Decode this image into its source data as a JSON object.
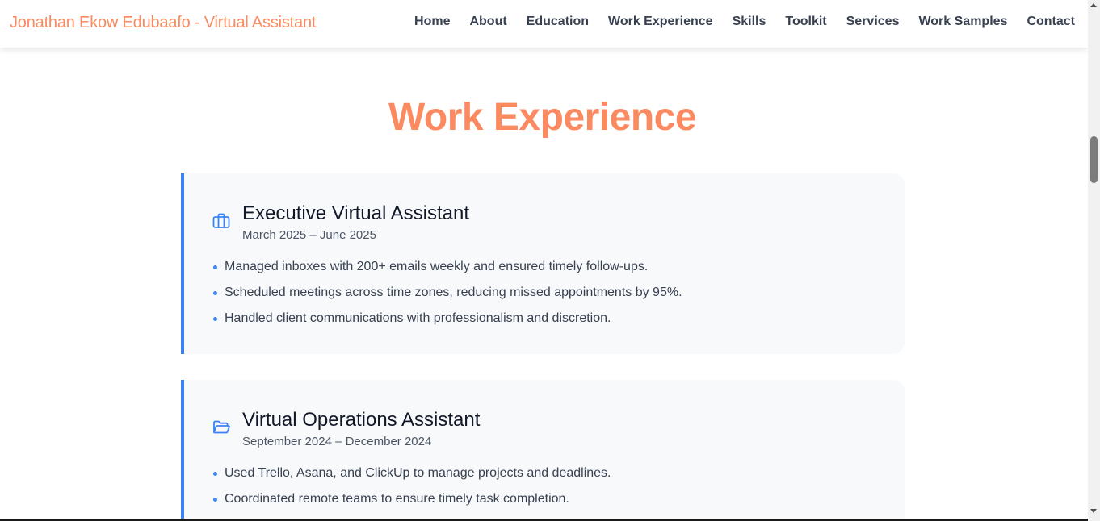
{
  "header": {
    "brand": "Jonathan Ekow Edubaafo - Virtual Assistant",
    "nav": [
      "Home",
      "About",
      "Education",
      "Work Experience",
      "Skills",
      "Toolkit",
      "Services",
      "Work Samples",
      "Contact"
    ]
  },
  "section": {
    "title": "Work Experience"
  },
  "jobs": [
    {
      "icon": "briefcase-icon",
      "title": "Executive Virtual Assistant",
      "dates": "March 2025 – June 2025",
      "bullets": [
        "Managed inboxes with 200+ emails weekly and ensured timely follow-ups.",
        "Scheduled meetings across time zones, reducing missed appointments by 95%.",
        "Handled client communications with professionalism and discretion."
      ]
    },
    {
      "icon": "folder-open-icon",
      "title": "Virtual Operations Assistant",
      "dates": "September 2024 – December 2024",
      "bullets": [
        "Used Trello, Asana, and ClickUp to manage projects and deadlines.",
        "Coordinated remote teams to ensure timely task completion."
      ]
    }
  ],
  "colors": {
    "accent": "#fb8a60",
    "card_border": "#3b82f6",
    "card_bg": "#f8f9fb"
  }
}
